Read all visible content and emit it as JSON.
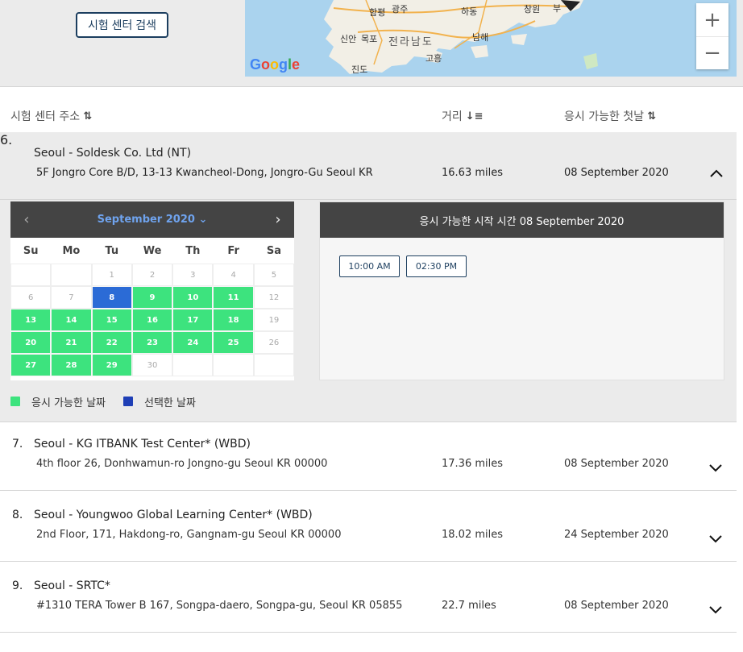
{
  "search": {
    "button_label": "시험 센터 검색"
  },
  "map": {
    "labels": [
      "함평",
      "광주",
      "하동",
      "창원",
      "부",
      "신안",
      "목포",
      "전라남도",
      "남해",
      "고흥",
      "진도"
    ],
    "logo": "Google",
    "zoom_in": "+",
    "zoom_out": "−"
  },
  "columns": {
    "address": "시험 센터 주소",
    "distance": "거리",
    "first_date": "응시 가능한 첫날"
  },
  "centers": [
    {
      "index": "6.",
      "name": "Seoul - Soldesk Co. Ltd (NT)",
      "address": "5F Jongro Core B/D, 13-13 Kwancheol-Dong, Jongro-Gu Seoul KR",
      "distance": "16.63 miles",
      "date": "08 September 2020"
    },
    {
      "index": "7.",
      "name": "Seoul - KG ITBANK Test Center* (WBD)",
      "address": "4th floor 26, Donhwamun-ro Jongno-gu Seoul KR 00000",
      "distance": "17.36 miles",
      "date": "08 September 2020"
    },
    {
      "index": "8.",
      "name": "Seoul - Youngwoo Global Learning Center* (WBD)",
      "address": "2nd Floor, 171, Hakdong-ro, Gangnam-gu Seoul KR 00000",
      "distance": "18.02 miles",
      "date": "24 September 2020"
    },
    {
      "index": "9.",
      "name": "Seoul - SRTC*",
      "address": "#1310 TERA Tower B 167, Songpa-daero, Songpa-gu, Seoul KR 05855",
      "distance": "22.7 miles",
      "date": "08 September 2020"
    }
  ],
  "calendar": {
    "month_label": "September 2020",
    "weekdays": [
      "Su",
      "Mo",
      "Tu",
      "We",
      "Th",
      "Fr",
      "Sa"
    ],
    "leading_blanks": 2,
    "days_in_month": 30,
    "selected_day": 8,
    "available_days": [
      8,
      9,
      10,
      11,
      13,
      14,
      15,
      16,
      17,
      18,
      20,
      21,
      22,
      23,
      24,
      25,
      27,
      28,
      29
    ],
    "colors": {
      "available": "#3de37e",
      "selected": "#2b6bd6",
      "header": "#444444"
    }
  },
  "legend": {
    "available_label": "응시 가능한 날짜",
    "selected_label": "선택한 날짜",
    "available_color": "#3de37e",
    "selected_color": "#1f3fb6"
  },
  "times": {
    "header": "응시 가능한 시작 시간 08 September 2020",
    "slots": [
      "10:00 AM",
      "02:30 PM"
    ]
  }
}
